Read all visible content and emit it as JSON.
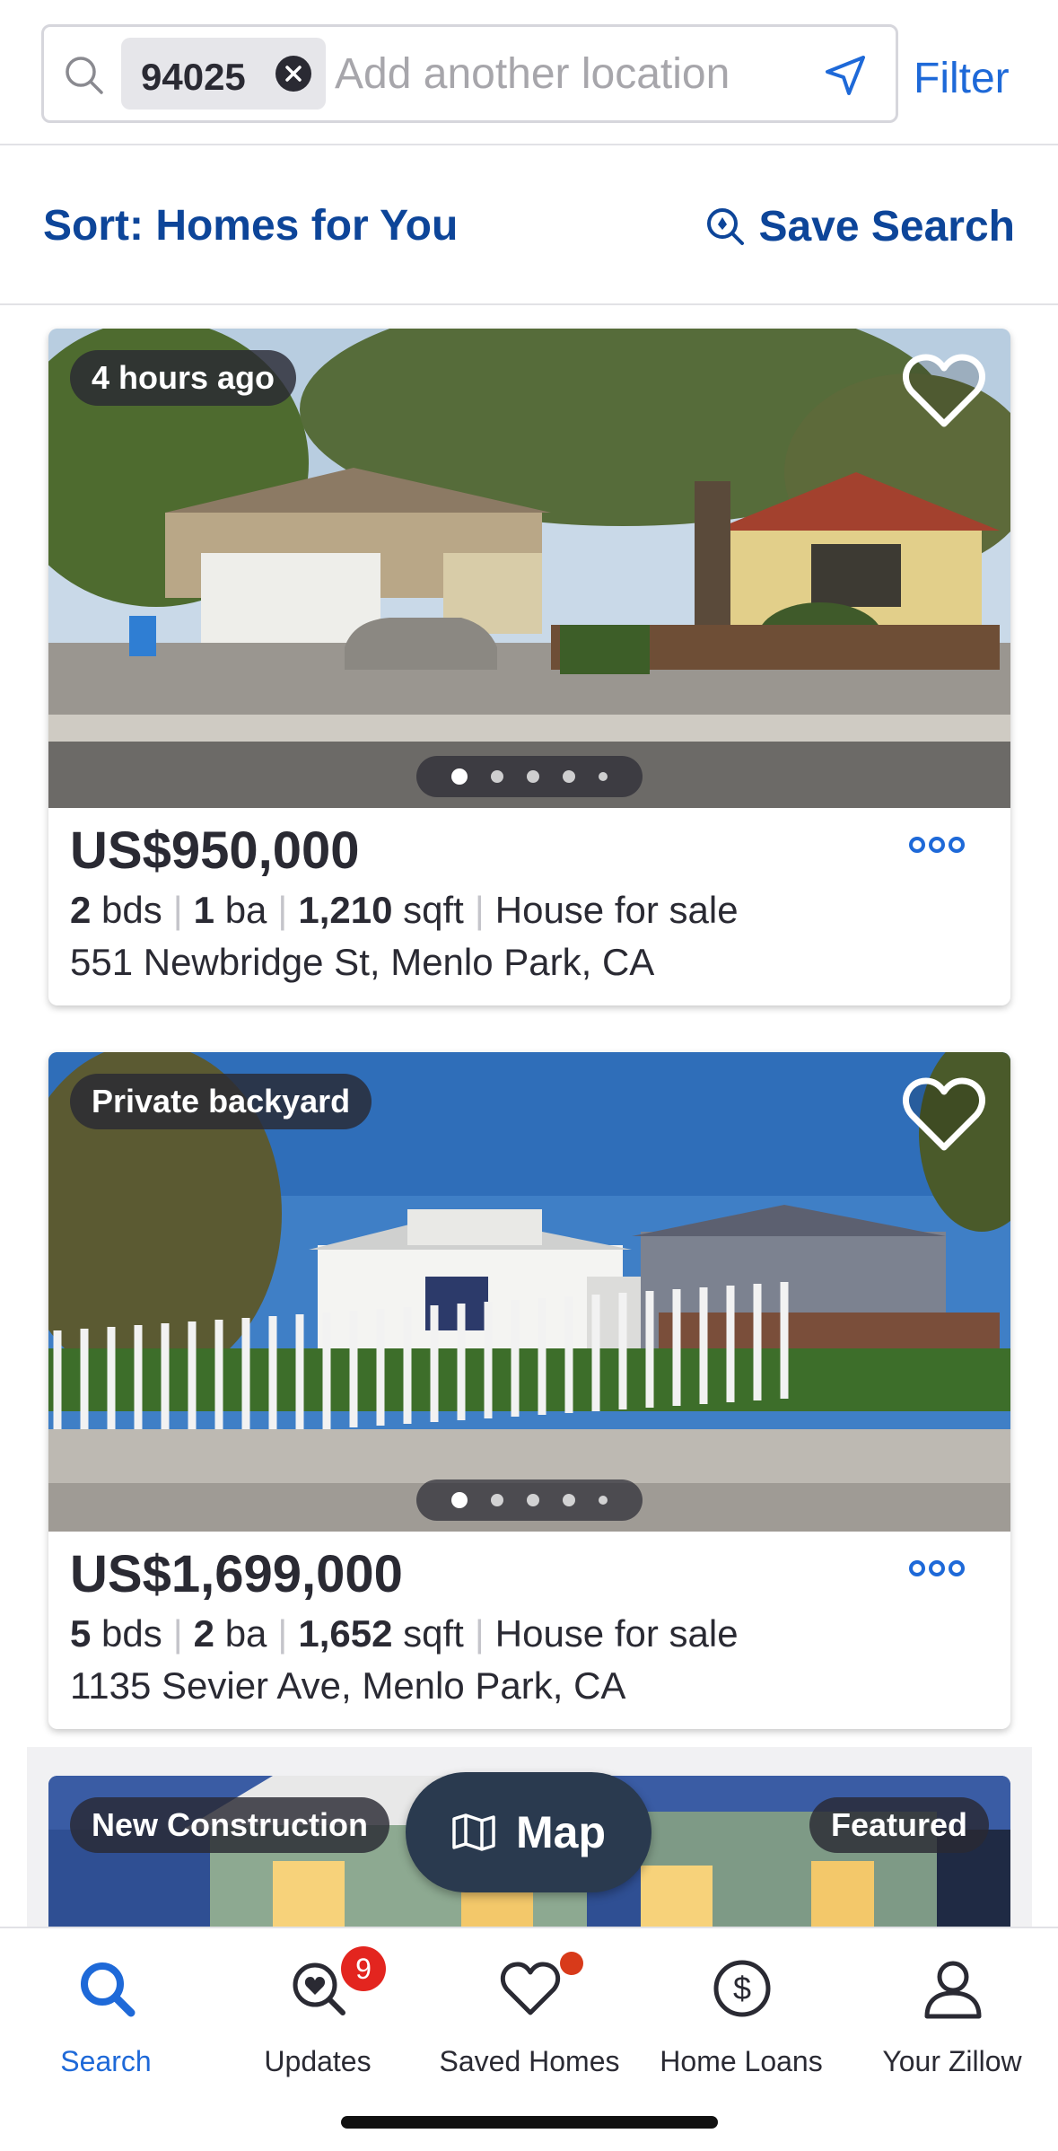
{
  "search": {
    "chip_value": "94025",
    "placeholder": "Add another location",
    "filter_label": "Filter"
  },
  "sort": {
    "label": "Sort: Homes for You",
    "save_search_label": "Save Search"
  },
  "listings": [
    {
      "tag": "4 hours ago",
      "price": "US$950,000",
      "beds": "2",
      "beds_unit": "bds",
      "baths": "1",
      "baths_unit": "ba",
      "sqft": "1,210",
      "sqft_unit": "sqft",
      "type": "House for sale",
      "address": "551 Newbridge St, Menlo Park, CA",
      "favorited": false,
      "photo_index": 1,
      "photo_count": 5
    },
    {
      "tag": "Private backyard",
      "price": "US$1,699,000",
      "beds": "5",
      "beds_unit": "bds",
      "baths": "2",
      "baths_unit": "ba",
      "sqft": "1,652",
      "sqft_unit": "sqft",
      "type": "House for sale",
      "address": "1135 Sevier Ave, Menlo Park, CA",
      "favorited": false,
      "photo_index": 1,
      "photo_count": 5
    },
    {
      "tag": "New Construction",
      "tag_right": "Featured"
    }
  ],
  "map_button": {
    "label": "Map"
  },
  "tabbar": {
    "tabs": [
      {
        "label": "Search",
        "icon": "search-icon",
        "active": true
      },
      {
        "label": "Updates",
        "icon": "updates-icon",
        "badge": "9"
      },
      {
        "label": "Saved Homes",
        "icon": "heart-icon",
        "dot": true
      },
      {
        "label": "Home Loans",
        "icon": "dollar-circle-icon"
      },
      {
        "label": "Your Zillow",
        "icon": "person-icon"
      }
    ]
  },
  "colors": {
    "accent_blue": "#1e69d8",
    "dark_blue": "#0d4599",
    "badge_red": "#e3251f"
  }
}
